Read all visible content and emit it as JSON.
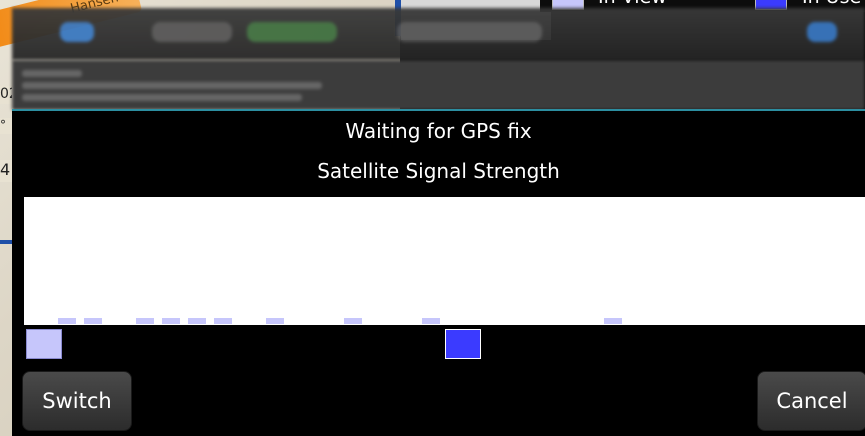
{
  "background": {
    "road_label": "Hansen",
    "legend": {
      "in_view_label": "In View",
      "in_use_label": "In Use",
      "in_view_color": "#c6c6fb",
      "in_use_color": "#3b3bff"
    },
    "edge_fragments": [
      "02",
      "°",
      "4"
    ]
  },
  "dialog": {
    "status": "Waiting for GPS fix",
    "title": "Satellite Signal Strength",
    "switch_label": "Switch",
    "cancel_label": "Cancel"
  },
  "chart_data": {
    "type": "bar",
    "title": "Satellite Signal Strength",
    "bar_color": "#c6c6fb",
    "series": [
      {
        "values": [
          1,
          1,
          1,
          1,
          1,
          1,
          1,
          1,
          1,
          1
        ]
      }
    ]
  },
  "satellites": [
    {
      "status": "in_view",
      "color": "#c6c6fb"
    },
    {
      "status": "in_use",
      "color": "#3b3bff"
    }
  ]
}
